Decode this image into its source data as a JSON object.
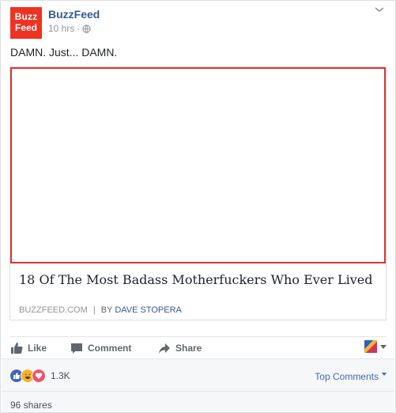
{
  "post": {
    "author": "BuzzFeed",
    "logo_line1": "Buzz",
    "logo_line2": "Feed",
    "time": "10 hrs",
    "meta_sep": "·",
    "text": "DAMN. Just... DAMN."
  },
  "link": {
    "title": "18 Of The Most Badass Motherfuckers Who Ever Lived",
    "domain": "BUZZFEED.COM",
    "separator": "|",
    "by": "BY",
    "author": "DAVE STOPERA"
  },
  "actions": {
    "like": "Like",
    "comment": "Comment",
    "share": "Share"
  },
  "footer": {
    "reaction_count": "1.3K",
    "top_comments": "Top Comments",
    "shares": "96 shares"
  },
  "colors": {
    "logo_red": "#ee3322",
    "link_blue": "#365899",
    "image_border": "#dd3333"
  },
  "icons": [
    "globe-icon",
    "chevron-down-icon",
    "like-icon",
    "comment-icon",
    "share-icon",
    "like-reaction-icon",
    "haha-reaction-icon",
    "love-reaction-icon",
    "caret-down-icon"
  ]
}
